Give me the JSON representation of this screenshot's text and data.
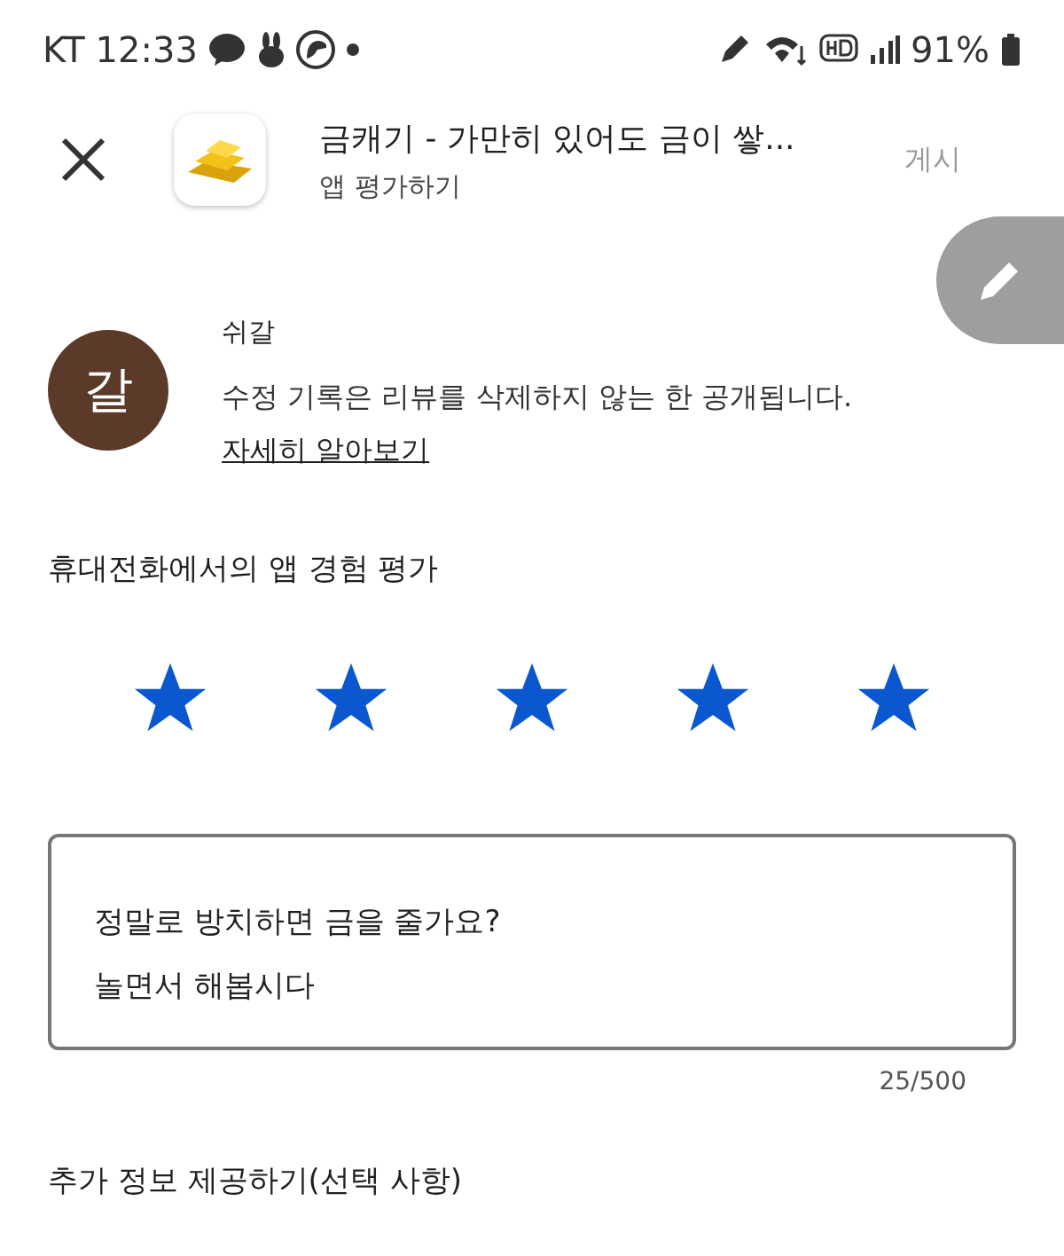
{
  "status_bar": {
    "carrier": "KT",
    "time": "12:33",
    "battery": "91%"
  },
  "header": {
    "app_title": "금캐기 - 가만히 있어도 금이 쌓...",
    "subtitle": "앱 평가하기",
    "post_button": {
      "label": "게시",
      "disabled": true
    }
  },
  "user": {
    "avatar_letter": "갈",
    "name": "쉬갈",
    "notice": "수정 기록은 리뷰를 삭제하지 않는 한 공개됩니다.",
    "link": "자세히 알아보기"
  },
  "rating": {
    "heading": "휴대전화에서의 앱 경험 평가",
    "stars": 5
  },
  "review": {
    "value": "정말로 방치하면 금을 줄가요?\n놀면서 해봅시다",
    "counter": "25/500"
  },
  "extra": {
    "heading": "추가 정보 제공하기(선택 사항)"
  }
}
